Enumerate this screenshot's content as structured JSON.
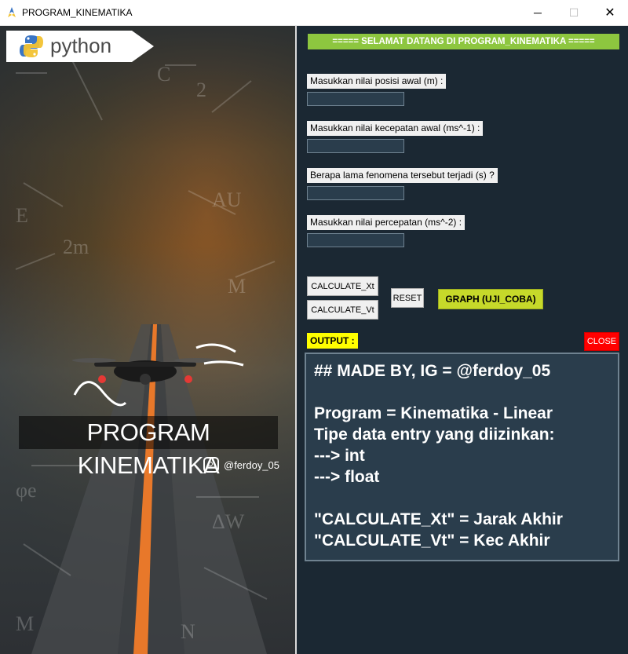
{
  "window": {
    "title": "PROGRAM_KINEMATIKA",
    "app_icon": "python-feather-icon",
    "minimize_glyph": "─",
    "maximize_glyph": "☐",
    "close_glyph": "✕"
  },
  "poster": {
    "python_logo_text": "python",
    "title": "PROGRAM KINEMATIKA",
    "instagram_handle": "@ferdoy_05",
    "instagram_icon": "instagram-icon"
  },
  "form": {
    "welcome": "===== SELAMAT DATANG DI PROGRAM_KINEMATIKA =====",
    "fields": [
      {
        "label": "Masukkan nilai posisi awal (m) :",
        "value": ""
      },
      {
        "label": "Masukkan nilai kecepatan awal (ms^-1) :",
        "value": ""
      },
      {
        "label": "Berapa lama fenomena tersebut terjadi (s) ?",
        "value": ""
      },
      {
        "label": "Masukkan nilai percepatan (ms^-2) :",
        "value": ""
      }
    ],
    "buttons": {
      "calc_xt": "CALCULATE_Xt",
      "calc_vt": "CALCULATE_Vt",
      "reset": "RESET",
      "graph": "GRAPH (UJI_COBA)",
      "close": "CLOSE"
    },
    "output_label": "OUTPUT :",
    "output_text": "## MADE BY, IG = @ferdoy_05\n\nProgram = Kinematika - Linear\nTipe data entry yang diizinkan:\n---> int\n---> float\n\n\"CALCULATE_Xt\" = Jarak Akhir\n\"CALCULATE_Vt\" = Kec Akhir"
  },
  "colors": {
    "panel_bg": "#1b2833",
    "welcome_bg": "#8dc63f",
    "graph_bg": "#c6d92a",
    "output_label_bg": "#ffff00",
    "close_bg": "#ff0000",
    "output_bg": "#2a3d4c"
  }
}
